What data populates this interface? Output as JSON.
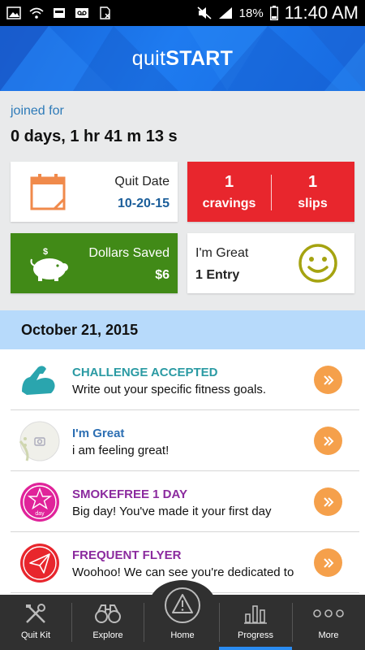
{
  "status_bar": {
    "battery": "18%",
    "time": "11:40 AM"
  },
  "header": {
    "brand_light": "quit",
    "brand_bold": "START"
  },
  "joined": {
    "label": "joined for",
    "value": "0 days, 1 hr 41 m 13 s"
  },
  "cards": {
    "quit_date": {
      "label": "Quit Date",
      "value": "10-20-15"
    },
    "cravings": {
      "count": "1",
      "label": "cravings"
    },
    "slips": {
      "count": "1",
      "label": "slips"
    },
    "dollars": {
      "label": "Dollars Saved",
      "value": "$6"
    },
    "mood": {
      "label": "I'm Great",
      "value": "1 Entry"
    }
  },
  "date_band": "October 21, 2015",
  "feed": [
    {
      "title": "CHALLENGE ACCEPTED",
      "desc": "Write out your specific fitness goals.",
      "color": "#2a9aa3",
      "icon": "flexed-arm-icon"
    },
    {
      "title": "I'm Great",
      "desc": "i am feeling great!",
      "color": "#2d6fb3",
      "icon": "camera-icon"
    },
    {
      "title": "SMOKEFREE 1 DAY",
      "desc": "Big day! You've made it your first day",
      "color": "#8b2a9e",
      "icon": "star-badge-icon"
    },
    {
      "title": "FREQUENT FLYER",
      "desc": "Woohoo! We can see you're dedicated to",
      "color": "#8b2a9e",
      "icon": "paper-plane-icon"
    }
  ],
  "nav": {
    "quit_kit": "Quit Kit",
    "explore": "Explore",
    "home": "Home",
    "progress": "Progress",
    "more": "More"
  },
  "colors": {
    "accent_blue": "#1e7bf0",
    "red": "#e8262d",
    "green": "#418a17",
    "orange": "#f5a04b",
    "nav_bg": "#303030",
    "active_underline": "#2a8cf2"
  }
}
